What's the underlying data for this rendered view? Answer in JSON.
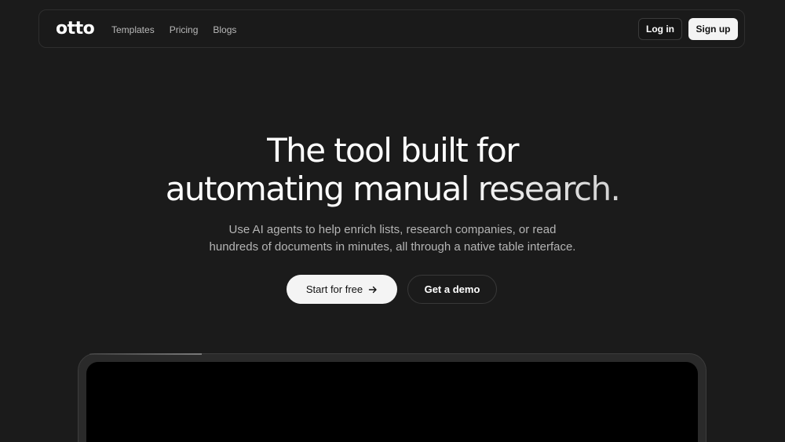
{
  "nav": {
    "logo": "otto",
    "links": [
      "Templates",
      "Pricing",
      "Blogs"
    ],
    "login_label": "Log in",
    "signup_label": "Sign up"
  },
  "hero": {
    "headline_line1": "The tool built for",
    "headline_line2": "automating manual research.",
    "sub_line1": "Use AI agents to help enrich lists, research companies, or read",
    "sub_line2": "hundreds of documents in minutes, all through a native table interface.",
    "primary_cta": "Start for free",
    "primary_cta_icon": "arrow-right-icon",
    "secondary_cta": "Get a demo"
  },
  "colors": {
    "background": "#1b1b1b",
    "primary_button": "#f4f4f4",
    "text": "#ffffff",
    "muted_text": "#b4b4b4"
  }
}
